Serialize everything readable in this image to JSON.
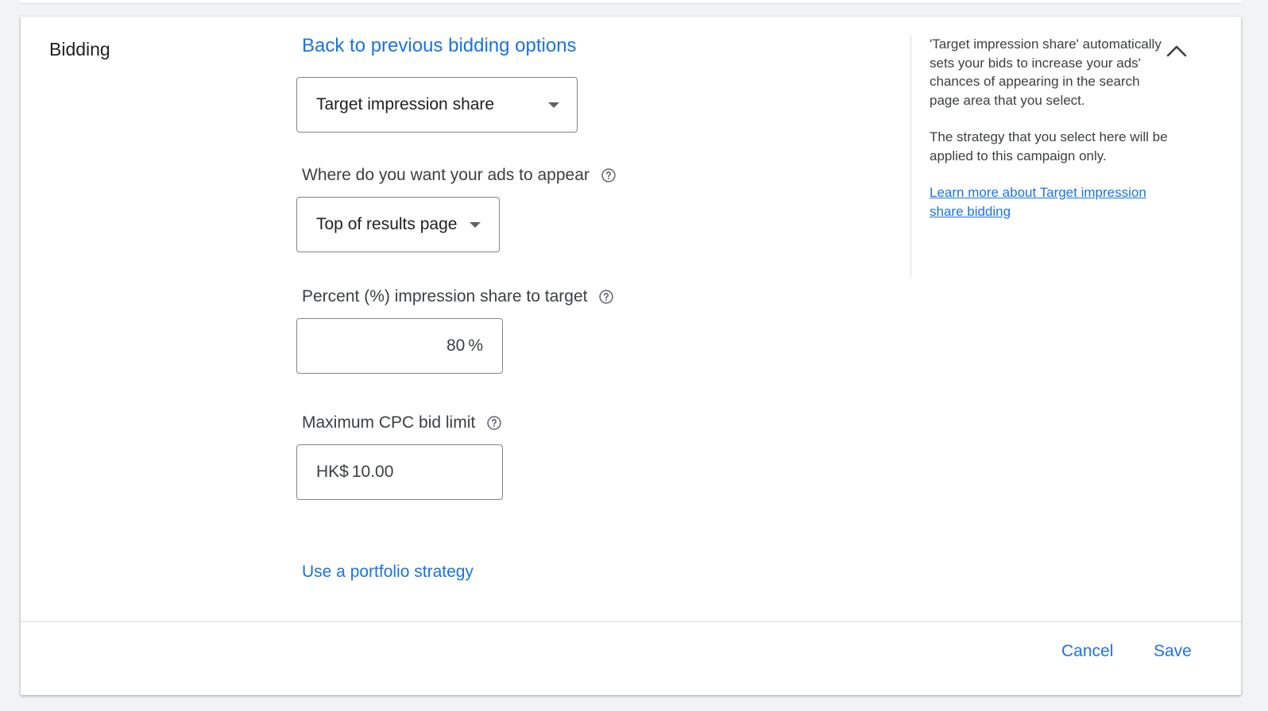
{
  "section": {
    "title": "Bidding"
  },
  "bidding": {
    "back_link": "Back to previous bidding options",
    "strategy_select": {
      "value": "Target impression share"
    },
    "placement": {
      "label": "Where do you want your ads to appear",
      "value": "Top of results page"
    },
    "percent": {
      "label": "Percent (%) impression share to target",
      "value": "80",
      "suffix": "%"
    },
    "max_cpc": {
      "label": "Maximum CPC bid limit",
      "prefix": "HK$",
      "value": "10.00"
    },
    "portfolio_link": "Use a portfolio strategy"
  },
  "help_panel": {
    "paragraph1": "'Target impression share' automatically sets your bids to increase your ads' chances of appearing in the search page area that you select.",
    "paragraph2": "The strategy that you select here will be applied to this campaign only.",
    "learn_more": "Learn more about Target impression share bidding"
  },
  "footer": {
    "cancel": "Cancel",
    "save": "Save"
  },
  "icons": {
    "help": "help-circle-icon",
    "collapse": "chevron-up-icon",
    "dropdown": "caret-down-icon"
  },
  "colors": {
    "link": "#1a73e8",
    "text": "#202124",
    "border": "#80868b",
    "background": "#f1f3f4"
  }
}
